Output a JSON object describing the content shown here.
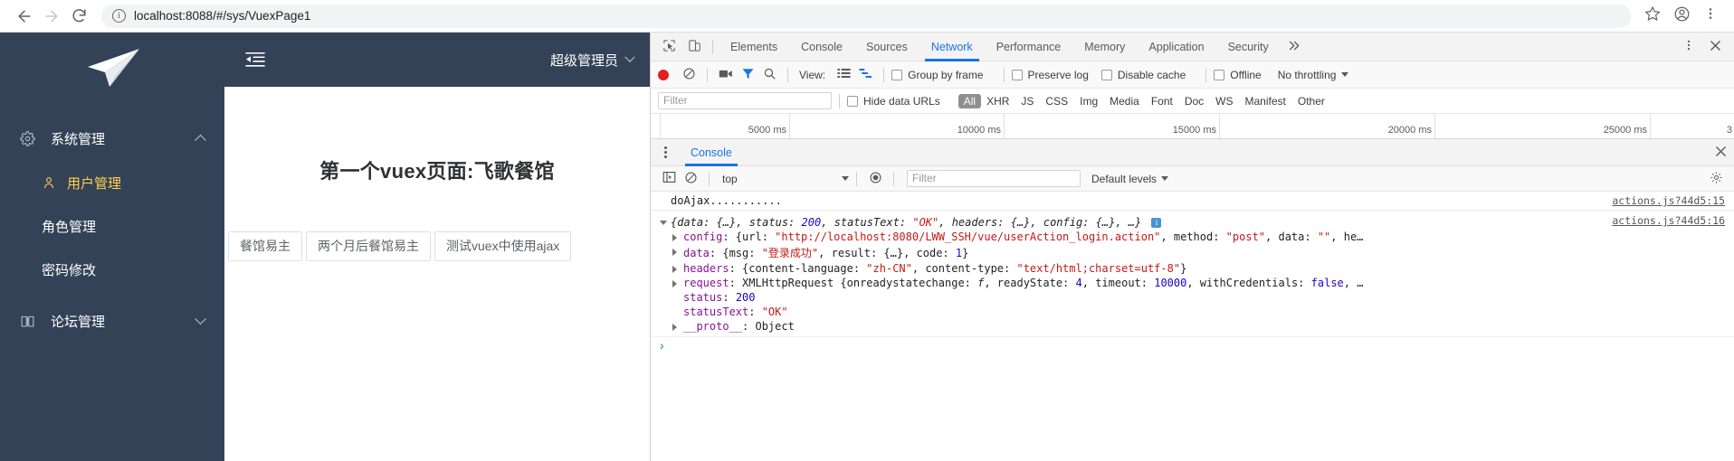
{
  "browser": {
    "back_icon": "arrow-left-icon",
    "forward_icon": "arrow-right-icon",
    "reload_icon": "reload-icon",
    "info_icon": "info-circle-icon",
    "url_host": "localhost",
    "url_rest": ":8088/#/sys/VuexPage1",
    "url_full": "localhost:8088/#/sys/VuexPage1",
    "bookmark_icon": "star-icon",
    "profile_icon": "avatar-icon",
    "menu_icon": "kebab-menu-icon"
  },
  "sidebar": {
    "logo_icon": "paper-plane-logo",
    "groups": [
      {
        "label": "系统管理",
        "icon": "gear-icon",
        "expanded": true,
        "children": [
          {
            "label": "用户管理",
            "icon": "user-icon",
            "active": true
          },
          {
            "label": "角色管理",
            "icon": "",
            "active": false
          },
          {
            "label": "密码修改",
            "icon": "",
            "active": false
          }
        ]
      },
      {
        "label": "论坛管理",
        "icon": "book-icon",
        "expanded": false,
        "children": []
      }
    ]
  },
  "app": {
    "collapse_icon": "menu-fold-icon",
    "user_name": "超级管理员",
    "user_caret_icon": "chevron-down-icon",
    "page_title": "第一个vuex页面:飞歌餐馆",
    "buttons": [
      "餐馆易主",
      "两个月后餐馆易主",
      "测试vuex中使用ajax"
    ]
  },
  "devtools": {
    "inspect_icon": "inspect-element-icon",
    "device_icon": "device-toolbar-icon",
    "tabs": [
      {
        "label": "Elements",
        "active": false
      },
      {
        "label": "Console",
        "active": false
      },
      {
        "label": "Sources",
        "active": false
      },
      {
        "label": "Network",
        "active": true
      },
      {
        "label": "Performance",
        "active": false
      },
      {
        "label": "Memory",
        "active": false
      },
      {
        "label": "Application",
        "active": false
      },
      {
        "label": "Security",
        "active": false
      }
    ],
    "more_tabs_icon": "chevron-double-right-icon",
    "settings_icon": "kebab-menu-icon",
    "close_icon": "close-icon",
    "network_toolbar": {
      "record_icon": "record-dot-icon",
      "clear_icon": "clear-circle-slash-icon",
      "capture_screenshots_icon": "camera-icon",
      "filter_icon": "funnel-icon",
      "search_icon": "magnifier-icon",
      "view_label": "View:",
      "view_list_icon": "list-view-icon",
      "view_waterfall_icon": "waterfall-view-icon",
      "checkboxes": [
        {
          "label": "Group by frame",
          "checked": false
        },
        {
          "label": "Preserve log",
          "checked": false
        },
        {
          "label": "Disable cache",
          "checked": false
        },
        {
          "label": "Offline",
          "checked": false
        }
      ],
      "throttling": "No throttling",
      "throttling_caret_icon": "chevron-down-icon"
    },
    "filter_bar": {
      "filter_placeholder": "Filter",
      "hide_data_urls_label": "Hide data URLs",
      "hide_data_urls_checked": false,
      "types": [
        "All",
        "XHR",
        "JS",
        "CSS",
        "Img",
        "Media",
        "Font",
        "Doc",
        "WS",
        "Manifest",
        "Other"
      ],
      "active_type": "All"
    },
    "timeline_ticks": [
      "5000 ms",
      "10000 ms",
      "15000 ms",
      "20000 ms",
      "25000 ms"
    ],
    "timeline_trailing": "3",
    "console_drawer": {
      "kebab_icon": "kebab-menu-icon",
      "tab_label": "Console",
      "close_icon": "close-icon",
      "sidebar_toggle_icon": "show-console-sidebar-icon",
      "clear_icon": "clear-circle-slash-icon",
      "context": "top",
      "context_caret_icon": "chevron-down-icon",
      "eye_icon": "live-expression-eye-icon",
      "filter_placeholder": "Filter",
      "levels_label": "Default levels",
      "levels_caret_icon": "chevron-down-icon",
      "settings_gear_icon": "gear-icon",
      "logs": [
        {
          "type": "text",
          "text": "doAjax...........",
          "source": "actions.js?44d5:15"
        },
        {
          "type": "object",
          "source": "actions.js?44d5:16",
          "summary_parts": [
            {
              "t": "{data: {…}, status: ",
              "c": "plain"
            },
            {
              "t": "200",
              "c": "num"
            },
            {
              "t": ", statusText: ",
              "c": "plain"
            },
            {
              "t": "\"OK\"",
              "c": "str"
            },
            {
              "t": ", headers: {…}, config: {…}, …}",
              "c": "plain"
            }
          ],
          "children": [
            {
              "key": "config",
              "parts": [
                {
                  "t": ": {url: ",
                  "c": "plain"
                },
                {
                  "t": "\"http://localhost:8080/LWW_SSH/vue/userAction_login.action\"",
                  "c": "str"
                },
                {
                  "t": ", method: ",
                  "c": "plain"
                },
                {
                  "t": "\"post\"",
                  "c": "str"
                },
                {
                  "t": ", data: ",
                  "c": "plain"
                },
                {
                  "t": "\"\"",
                  "c": "str"
                },
                {
                  "t": ", he…",
                  "c": "plain"
                }
              ]
            },
            {
              "key": "data",
              "parts": [
                {
                  "t": ": {msg: ",
                  "c": "plain"
                },
                {
                  "t": "\"登录成功\"",
                  "c": "str"
                },
                {
                  "t": ", result: {…}, code: ",
                  "c": "plain"
                },
                {
                  "t": "1",
                  "c": "num"
                },
                {
                  "t": "}",
                  "c": "plain"
                }
              ]
            },
            {
              "key": "headers",
              "parts": [
                {
                  "t": ": {content-language: ",
                  "c": "plain"
                },
                {
                  "t": "\"zh-CN\"",
                  "c": "str"
                },
                {
                  "t": ", content-type: ",
                  "c": "plain"
                },
                {
                  "t": "\"text/html;charset=utf-8\"",
                  "c": "str"
                },
                {
                  "t": "}",
                  "c": "plain"
                }
              ]
            },
            {
              "key": "request",
              "parts": [
                {
                  "t": ": XMLHttpRequest {onreadystatechange: ",
                  "c": "plain"
                },
                {
                  "t": "f",
                  "c": "ital"
                },
                {
                  "t": ", readyState: ",
                  "c": "plain"
                },
                {
                  "t": "4",
                  "c": "num"
                },
                {
                  "t": ", timeout: ",
                  "c": "plain"
                },
                {
                  "t": "10000",
                  "c": "num"
                },
                {
                  "t": ", withCredentials: ",
                  "c": "plain"
                },
                {
                  "t": "false",
                  "c": "num"
                },
                {
                  "t": ", …",
                  "c": "plain"
                }
              ]
            },
            {
              "key": "status",
              "noarrow": true,
              "parts": [
                {
                  "t": ": ",
                  "c": "plain"
                },
                {
                  "t": "200",
                  "c": "num"
                }
              ]
            },
            {
              "key": "statusText",
              "noarrow": true,
              "parts": [
                {
                  "t": ": ",
                  "c": "plain"
                },
                {
                  "t": "\"OK\"",
                  "c": "str"
                }
              ]
            },
            {
              "key": "__proto__",
              "parts": [
                {
                  "t": ": Object",
                  "c": "plain"
                }
              ]
            }
          ]
        }
      ],
      "prompt_icon": "chevron-right-icon"
    }
  }
}
